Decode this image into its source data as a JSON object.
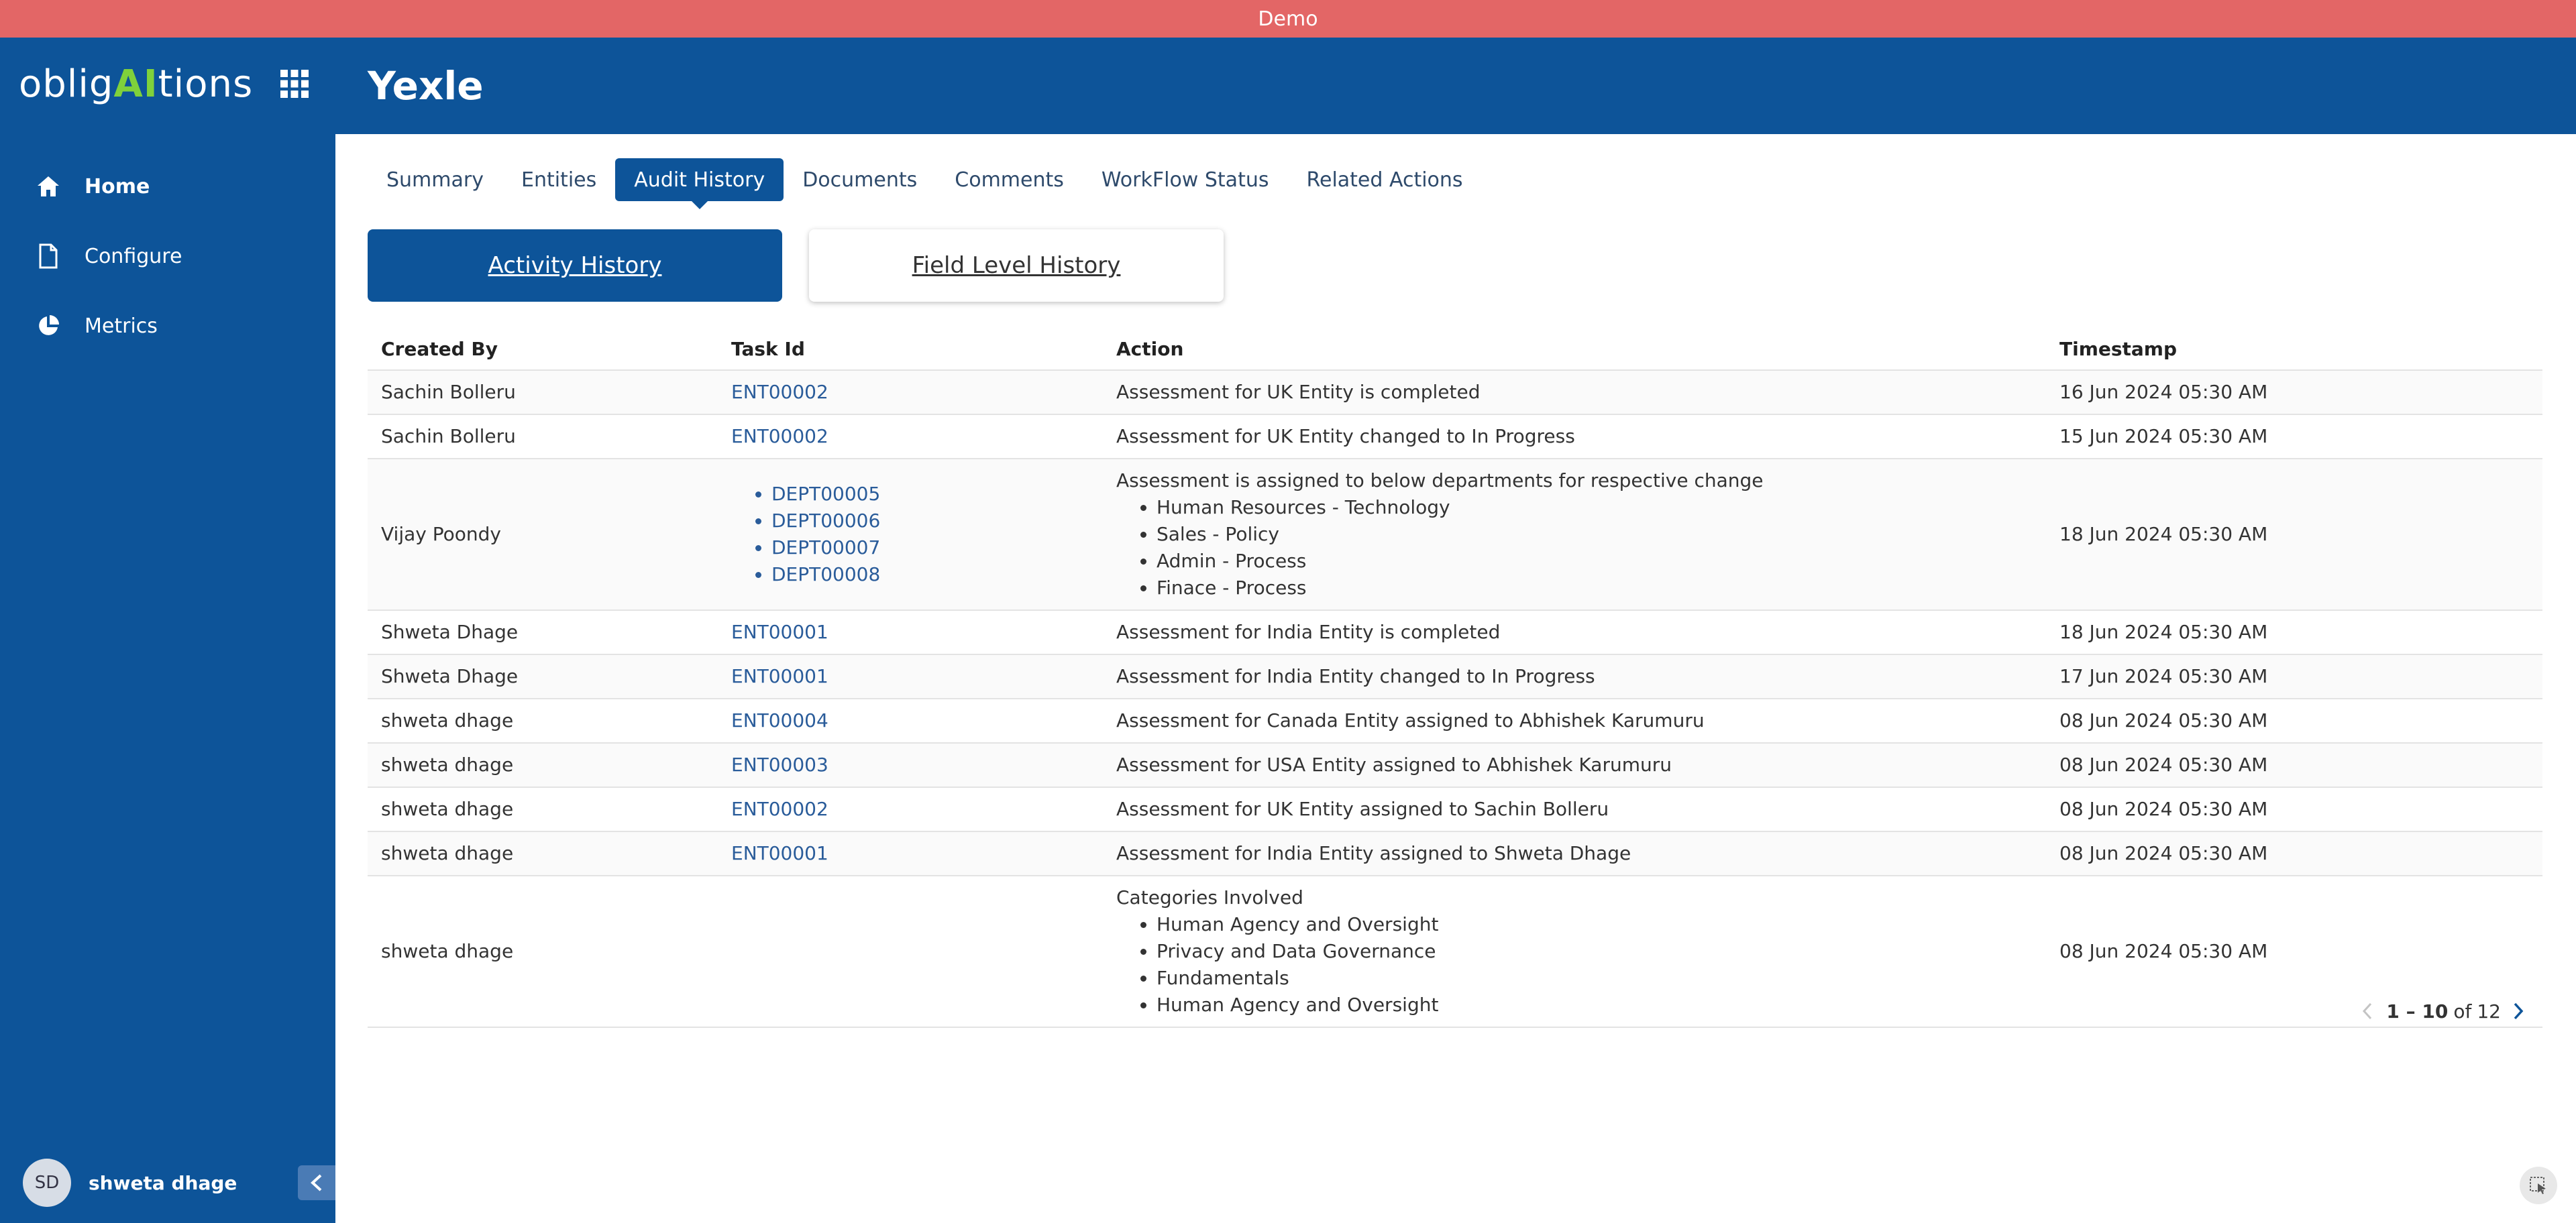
{
  "banner": {
    "text": "Demo"
  },
  "sidebar": {
    "logo": {
      "part1": "oblig",
      "part2": "AI",
      "part3": "tions"
    },
    "items": [
      {
        "label": "Home",
        "icon": "home-icon",
        "active": true
      },
      {
        "label": "Configure",
        "icon": "document-icon",
        "active": false
      },
      {
        "label": "Metrics",
        "icon": "pie-chart-icon",
        "active": false
      }
    ],
    "user": {
      "initials": "SD",
      "name": "shweta dhage"
    }
  },
  "header": {
    "title": "Yexle"
  },
  "tabs": [
    {
      "label": "Summary",
      "active": false
    },
    {
      "label": "Entities",
      "active": false
    },
    {
      "label": "Audit History",
      "active": true
    },
    {
      "label": "Documents",
      "active": false
    },
    {
      "label": "Comments",
      "active": false
    },
    {
      "label": "WorkFlow Status",
      "active": false
    },
    {
      "label": "Related Actions",
      "active": false
    }
  ],
  "history_toggle": {
    "activity": "Activity History",
    "field_level": "Field Level History"
  },
  "table": {
    "columns": [
      "Created By",
      "Task Id",
      "Action",
      "Timestamp"
    ],
    "rows": [
      {
        "created_by": "Sachin Bolleru",
        "task_id": "ENT00002",
        "action": "Assessment for UK Entity is completed",
        "timestamp": "16 Jun 2024 05:30 AM"
      },
      {
        "created_by": "Sachin Bolleru",
        "task_id": "ENT00002",
        "action": "Assessment for UK Entity changed to In Progress",
        "timestamp": "15 Jun 2024 05:30 AM"
      },
      {
        "created_by": "Vijay Poondy",
        "task_ids": [
          "DEPT00005",
          "DEPT00006",
          "DEPT00007",
          "DEPT00008"
        ],
        "action": "Assessment is assigned to below departments for respective change",
        "action_items": [
          "Human Resources - Technology",
          "Sales - Policy",
          "Admin - Process",
          "Finace - Process"
        ],
        "timestamp": "18 Jun 2024 05:30 AM"
      },
      {
        "created_by": "Shweta Dhage",
        "task_id": "ENT00001",
        "action": "Assessment for India Entity is completed",
        "timestamp": "18 Jun 2024 05:30 AM"
      },
      {
        "created_by": "Shweta Dhage",
        "task_id": "ENT00001",
        "action": "Assessment for India Entity changed to In Progress",
        "timestamp": "17 Jun 2024 05:30 AM"
      },
      {
        "created_by": "shweta dhage",
        "task_id": "ENT00004",
        "action": "Assessment for Canada Entity assigned to Abhishek Karumuru",
        "timestamp": "08 Jun 2024 05:30 AM"
      },
      {
        "created_by": "shweta dhage",
        "task_id": "ENT00003",
        "action": "Assessment for USA Entity assigned to Abhishek Karumuru",
        "timestamp": "08 Jun 2024 05:30 AM"
      },
      {
        "created_by": "shweta dhage",
        "task_id": "ENT00002",
        "action": "Assessment for UK Entity assigned to Sachin Bolleru",
        "timestamp": "08 Jun 2024 05:30 AM"
      },
      {
        "created_by": "shweta dhage",
        "task_id": "ENT00001",
        "action": "Assessment for India Entity assigned to Shweta Dhage",
        "timestamp": "08 Jun 2024 05:30 AM"
      },
      {
        "created_by": "shweta dhage",
        "task_id": "",
        "action": "Categories Involved",
        "action_items": [
          "Human Agency and Oversight",
          "Privacy and Data Governance",
          "Fundamentals",
          "Human Agency and Oversight"
        ],
        "timestamp": "08 Jun 2024 05:30 AM"
      }
    ]
  },
  "pagination": {
    "range": "1 – 10",
    "of_label": "of",
    "total": "12"
  },
  "colors": {
    "primary": "#0d5499",
    "banner": "#e36666",
    "logo_accent": "#7fd13b",
    "link": "#2a5c9a"
  }
}
